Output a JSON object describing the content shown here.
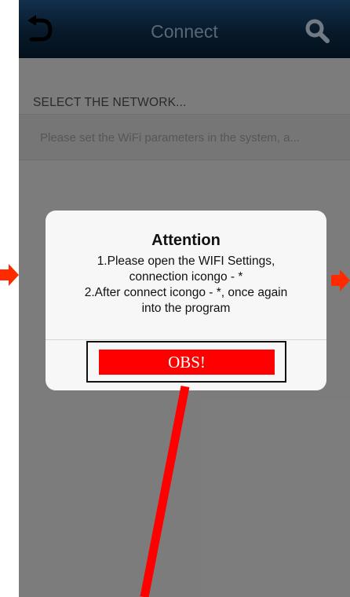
{
  "navbar": {
    "title": "Connect",
    "back_icon": "back-arrow-icon",
    "search_icon": "search-icon"
  },
  "section_label": "SELECT THE NETWORK...",
  "hint": "Please set the WiFi parameters in the system, a...",
  "dialog": {
    "title": "Attention",
    "lines": [
      "1.Please open the WIFI Settings,",
      "connection icongo - *",
      "2.After connect icongo - *, once again",
      "into the program"
    ],
    "ok_label": "OBS!"
  },
  "colors": {
    "navbar": "#0d2a45",
    "background": "#c9c9c9",
    "annotation": "#ff0000"
  }
}
